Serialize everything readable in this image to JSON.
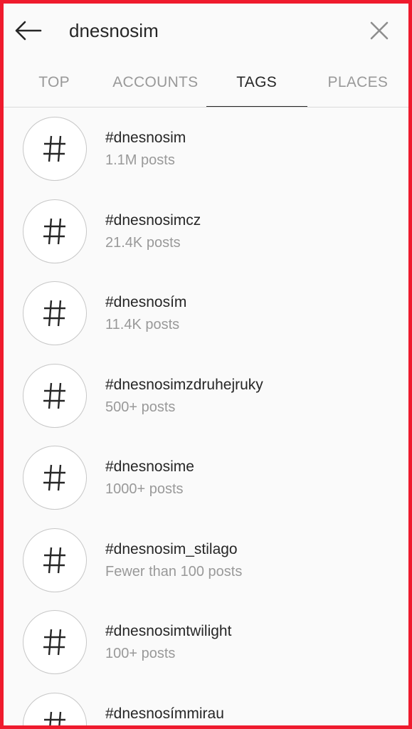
{
  "search": {
    "query": "dnesnosim",
    "back_icon": "arrow-left-icon",
    "clear_icon": "close-icon"
  },
  "tabs": [
    {
      "label": "TOP",
      "active": false
    },
    {
      "label": "ACCOUNTS",
      "active": false
    },
    {
      "label": "TAGS",
      "active": true
    },
    {
      "label": "PLACES",
      "active": false
    }
  ],
  "results": [
    {
      "tag": "#dnesnosim",
      "count": "1.1M posts"
    },
    {
      "tag": "#dnesnosimcz",
      "count": "21.4K posts"
    },
    {
      "tag": "#dnesnosím",
      "count": "11.4K posts"
    },
    {
      "tag": "#dnesnosimzdruhejruky",
      "count": "500+ posts"
    },
    {
      "tag": "#dnesnosime",
      "count": "1000+ posts"
    },
    {
      "tag": "#dnesnosim_stilago",
      "count": "Fewer than 100 posts"
    },
    {
      "tag": "#dnesnosimtwilight",
      "count": "100+ posts"
    },
    {
      "tag": "#dnesnosímmirau",
      "count": ""
    }
  ],
  "colors": {
    "frame_border": "#ef1a2d",
    "text_primary": "#262626",
    "text_secondary": "#999999"
  }
}
